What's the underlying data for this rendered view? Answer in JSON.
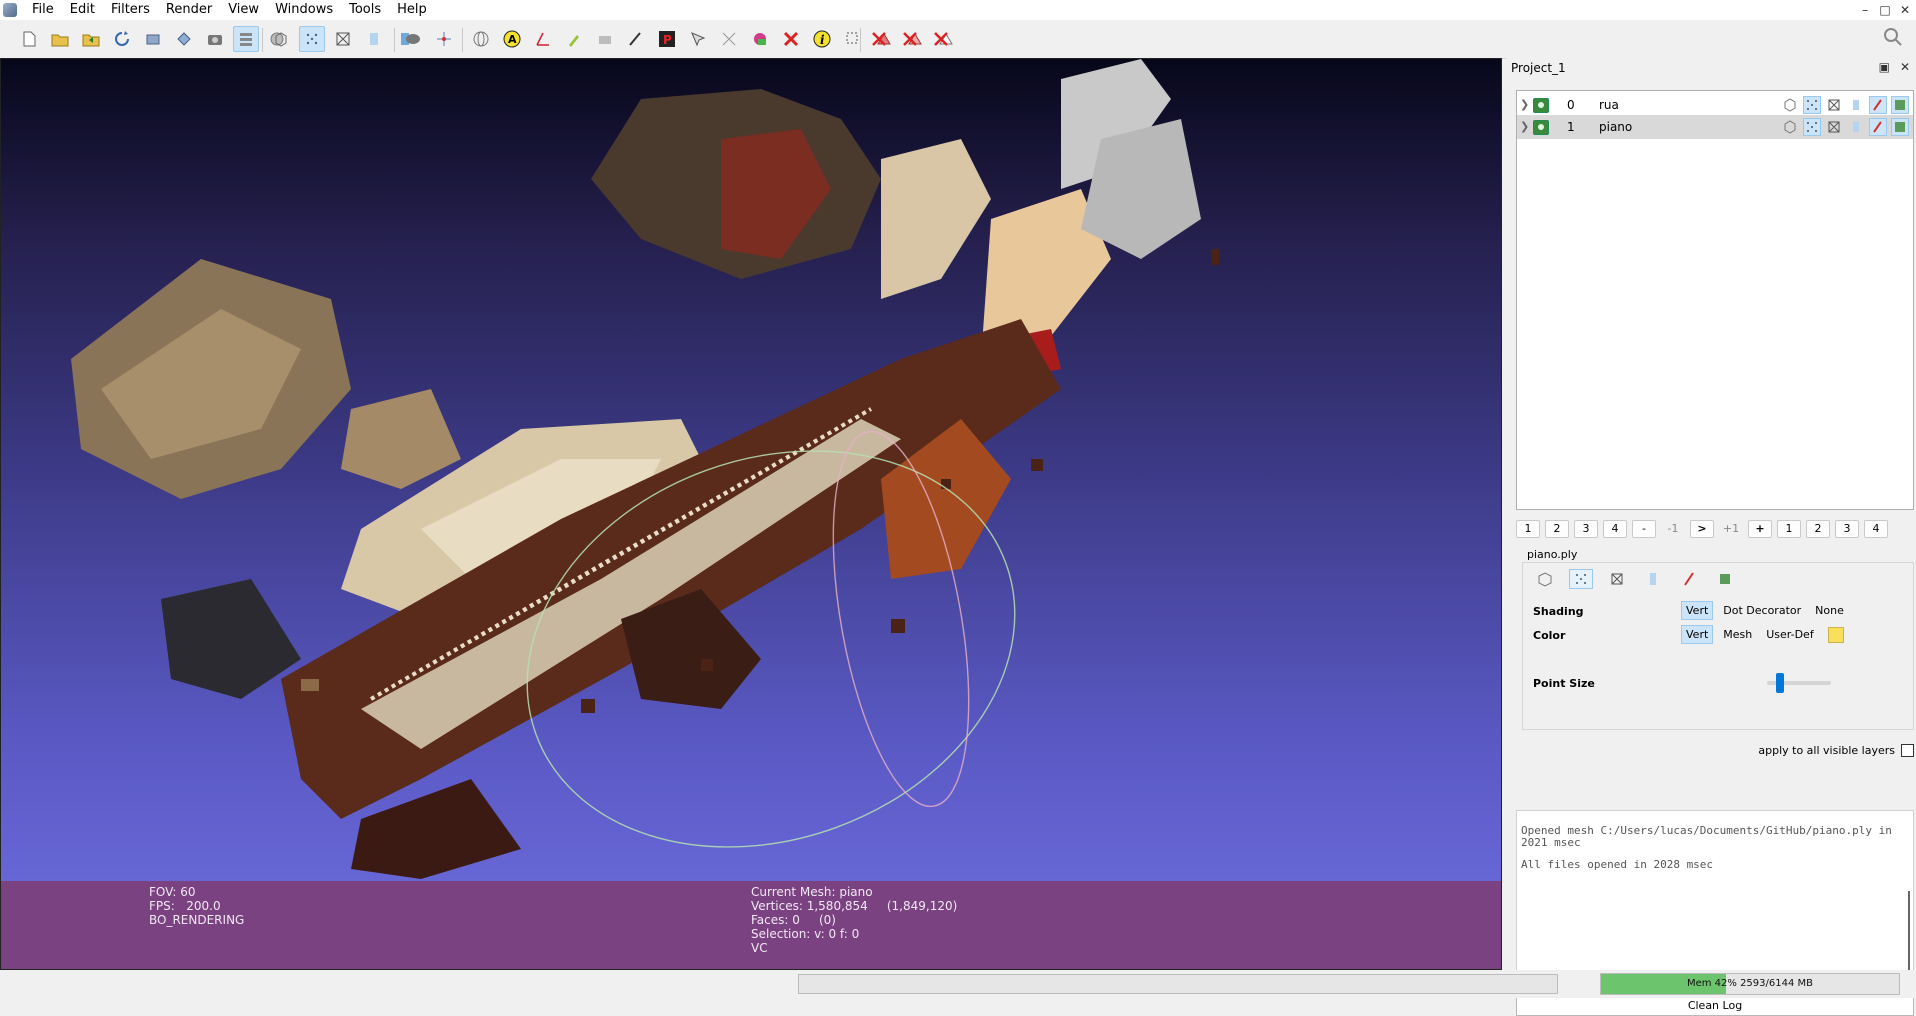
{
  "menu": [
    "File",
    "Edit",
    "Filters",
    "Render",
    "View",
    "Windows",
    "Tools",
    "Help"
  ],
  "window_controls": [
    "–",
    "□",
    "✕"
  ],
  "viewport_info": {
    "left_lines": [
      "FOV: 60",
      "FPS:   200.0",
      "BO_RENDERING"
    ],
    "right_lines": [
      "Current Mesh: piano",
      "Vertices: 1,580,854     (1,849,120)",
      "Faces: 0     (0)",
      "Selection: v: 0 f: 0",
      "VC"
    ]
  },
  "panel": {
    "title": "Project_1",
    "title_buttons": [
      "▣",
      "✕"
    ],
    "layers": [
      {
        "id": "0",
        "name": "rua",
        "selected": false
      },
      {
        "id": "1",
        "name": "piano",
        "selected": true
      }
    ],
    "nav_buttons": [
      "1",
      "2",
      "3",
      "4",
      "-",
      "-1",
      ">",
      "+1",
      "+",
      "1",
      "2",
      "3",
      "4"
    ],
    "decorator": {
      "title": "piano.ply",
      "shading_label": "Shading",
      "shading_options": [
        "Vert",
        "Dot Decorator",
        "None"
      ],
      "color_label": "Color",
      "color_options": [
        "Vert",
        "Mesh",
        "User-Def"
      ],
      "user_color": "#f8e05c",
      "point_size_label": "Point Size",
      "point_size_value": 0.2,
      "apply_label": "apply to all visible layers"
    },
    "log_lines": [
      "Opened mesh C:/Users/lucas/Documents/GitHub/piano.ply in 2021 msec",
      "All files opened in 2028 msec"
    ],
    "clean_log_label": "Clean Log"
  },
  "status": {
    "mem_text": "Mem 42% 2593/6144 MB",
    "mem_fraction": 0.42
  },
  "colors": {
    "info_bar": "#7a4280",
    "accent": "#0078d7",
    "trackball": "#b6e0b0"
  }
}
